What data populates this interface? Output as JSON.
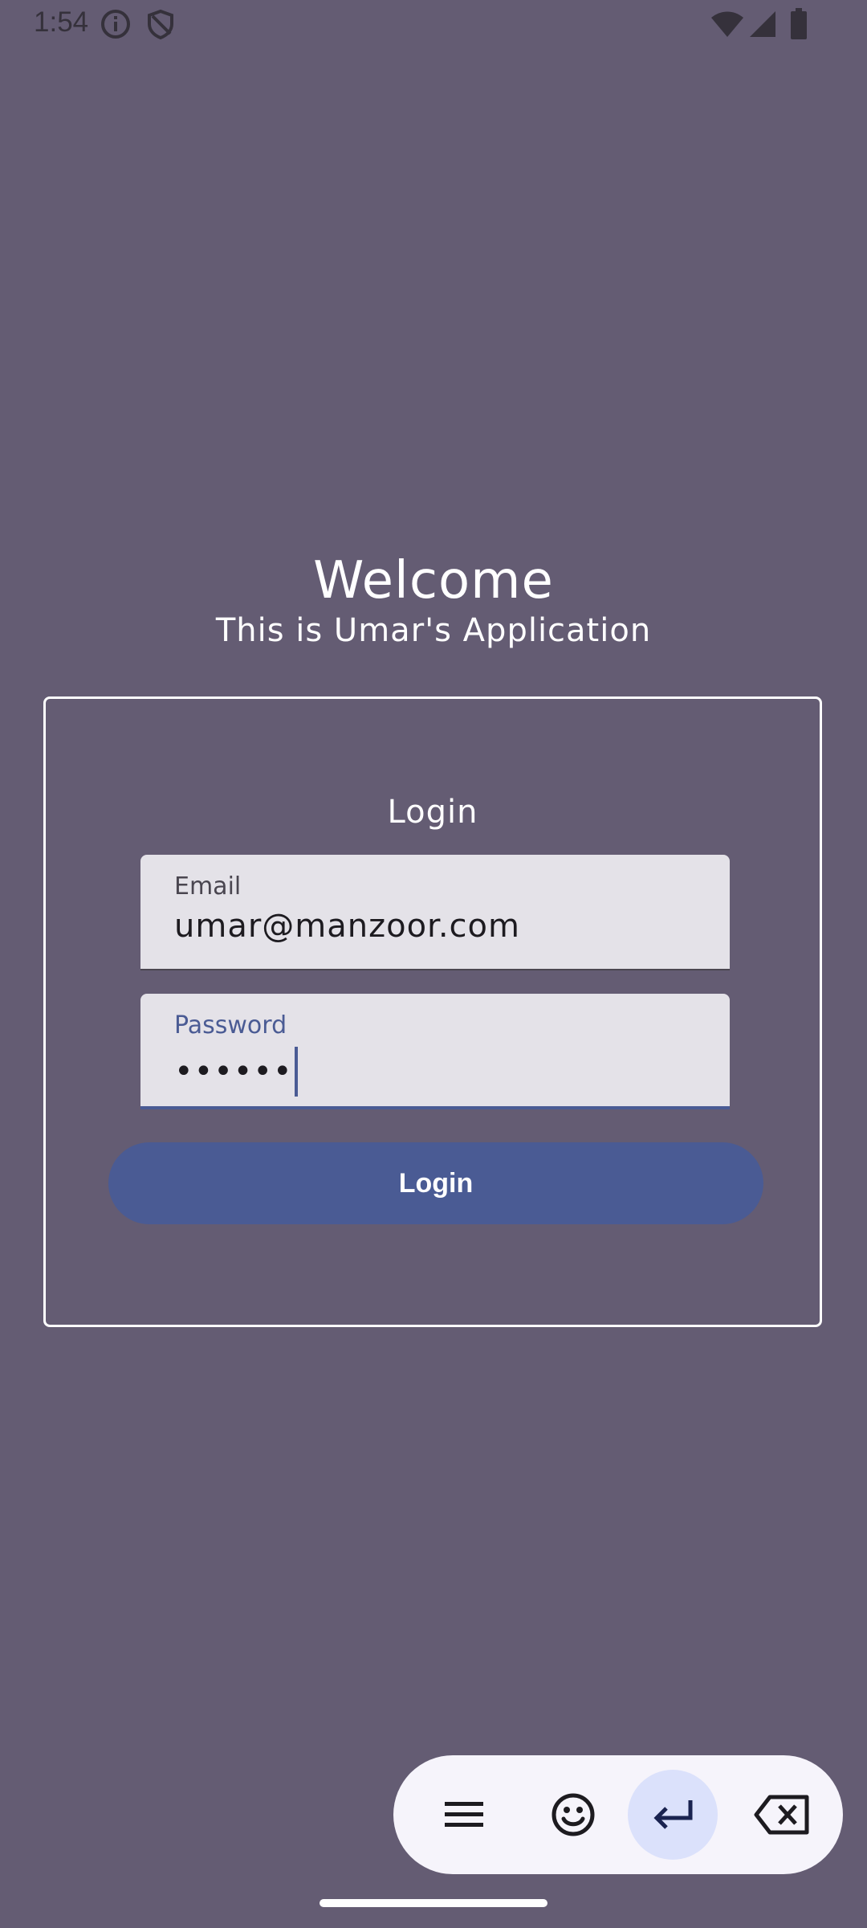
{
  "status_bar": {
    "time": "1:54",
    "icons": [
      "info-icon",
      "shield-icon",
      "wifi-icon",
      "signal-icon",
      "battery-icon"
    ]
  },
  "header": {
    "title": "Welcome",
    "subtitle": "This is Umar's Application"
  },
  "login_card": {
    "title": "Login",
    "email": {
      "label": "Email",
      "value": "umar@manzoor.com"
    },
    "password": {
      "label": "Password",
      "value": "••••••"
    },
    "button_label": "Login"
  },
  "keyboard_toolbar": {
    "buttons": [
      "menu-icon",
      "emoji-icon",
      "enter-icon",
      "backspace-icon"
    ]
  },
  "colors": {
    "background": "#645c73",
    "accent": "#4a5b94",
    "field_bg": "#e4e2e8"
  }
}
